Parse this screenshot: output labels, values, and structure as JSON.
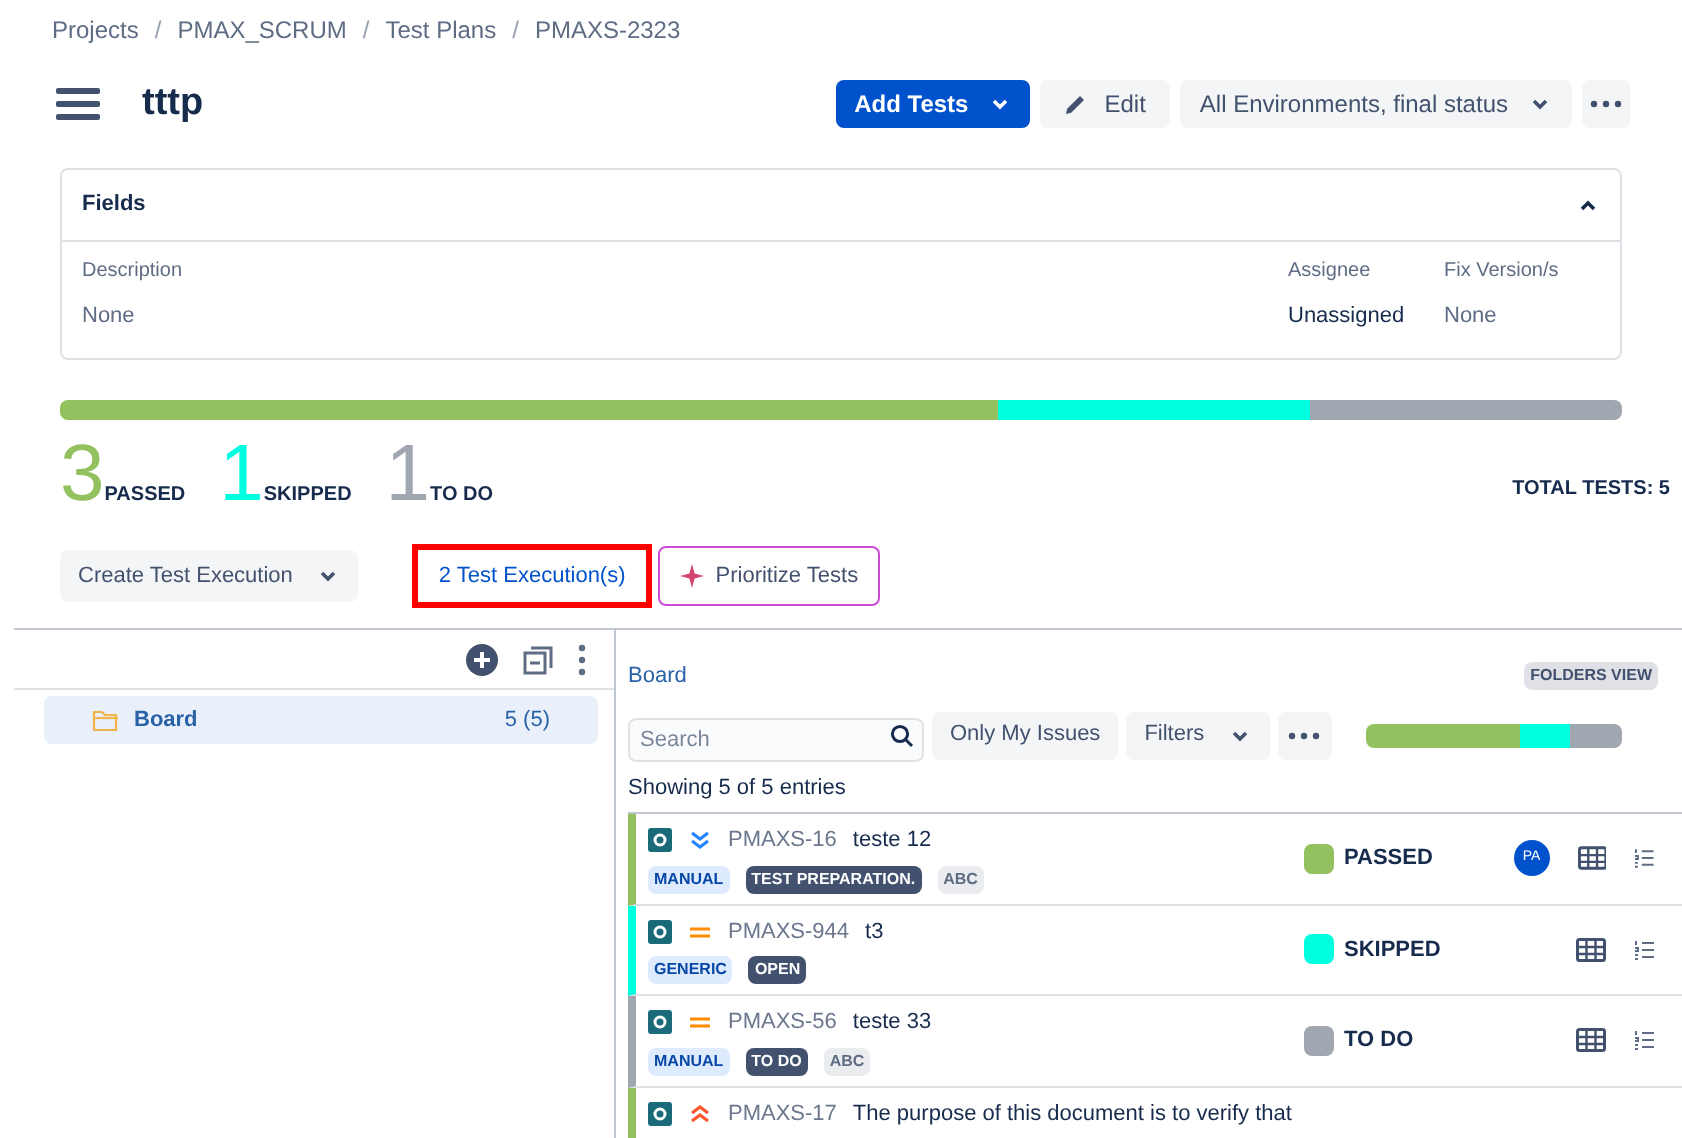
{
  "breadcrumbs": [
    {
      "kind": "link",
      "text": "Projects"
    },
    {
      "kind": "separator",
      "text": "/"
    },
    {
      "kind": "link",
      "text": "PMAX_SCRUM"
    },
    {
      "kind": "separator",
      "text": "/"
    },
    {
      "kind": "link",
      "text": "Test Plans"
    },
    {
      "kind": "separator",
      "text": "/"
    },
    {
      "kind": "link",
      "text": "PMAXS-2323"
    }
  ],
  "title": "tttp",
  "actions": {
    "add_tests": "Add Tests",
    "edit": "Edit",
    "environment": "All Environments, final status"
  },
  "fields": {
    "title": "Fields",
    "expanded": true,
    "items": [
      {
        "label": "Description",
        "value": "None",
        "kind": "link"
      },
      {
        "label": "Assignee",
        "value": "Unassigned",
        "kind": "plain"
      },
      {
        "label": "Fix Version/s",
        "value": "None",
        "kind": "link"
      }
    ]
  },
  "stats": [
    {
      "count": "3",
      "label": "PASSED",
      "color": "#94c160"
    },
    {
      "count": "1",
      "label": "SKIPPED",
      "color": "#00ffe0"
    },
    {
      "count": "1",
      "label": "TO DO",
      "color": "#a1a7b1"
    }
  ],
  "total": "TOTAL TESTS: 5",
  "create_execution": "Create Test Execution",
  "executions_link": "2 Test Execution(s)",
  "prioritize": "Prioritize Tests",
  "folders": [
    {
      "name": "Board",
      "count": "5 (5)",
      "selected": true
    }
  ],
  "board": {
    "title": "Board",
    "view_badge": "FOLDERS VIEW",
    "search": {
      "placeholder": "Search"
    },
    "only_mine": "Only My Issues",
    "filters": "Filters",
    "showing": "Showing 5 of 5 entries"
  },
  "tests": [
    {
      "key": "PMAXS-16",
      "summary": "teste 12",
      "priority_icon": {
        "kind": "lowest"
      },
      "tags": [
        {
          "text": "MANUAL",
          "kind": "type"
        },
        {
          "text": "TEST PREPARATION.",
          "kind": "status"
        },
        {
          "text": "ABC",
          "kind": "label"
        }
      ],
      "status": "PASSED",
      "color": "#94c160",
      "assignee": "PA"
    },
    {
      "key": "PMAXS-944",
      "summary": "t3",
      "priority_icon": {
        "kind": "medium"
      },
      "tags": [
        {
          "text": "GENERIC",
          "kind": "type"
        },
        {
          "text": "OPEN",
          "kind": "status"
        }
      ],
      "status": "SKIPPED",
      "color": "#00ffe0"
    },
    {
      "key": "PMAXS-56",
      "summary": "teste 33",
      "priority_icon": {
        "kind": "medium"
      },
      "tags": [
        {
          "text": "MANUAL",
          "kind": "type"
        },
        {
          "text": "TO DO",
          "kind": "status"
        },
        {
          "text": "ABC",
          "kind": "label"
        }
      ],
      "status": "TO DO",
      "color": "#a1a7b1"
    },
    {
      "key": "PMAXS-17",
      "summary": "The purpose of this document is to verify that",
      "priority_icon": {
        "kind": "highest"
      },
      "color": "#94c160"
    }
  ]
}
